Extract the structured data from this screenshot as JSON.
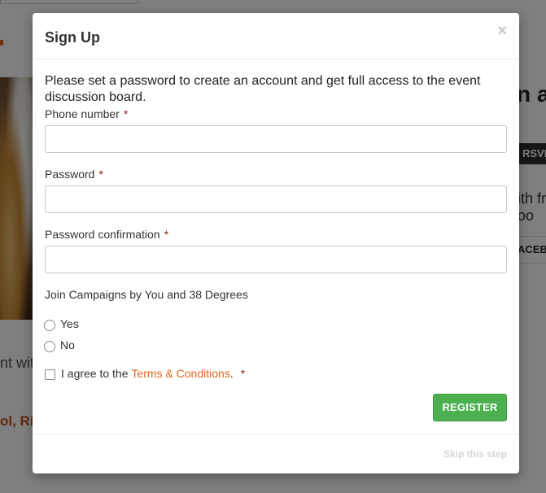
{
  "background": {
    "heading_fragment": "n at",
    "rsvp_label": "RSVP",
    "text_fragment_right": "ith fr\noo",
    "facebook_fragment": "ACEB",
    "text_fragment_left": "nt wit",
    "location_fragment": "ol, Riv"
  },
  "modal": {
    "title": "Sign Up",
    "close_symbol": "×",
    "intro": "Please set a password to create an account and get full access to the event discussion board.",
    "required_marker": "*",
    "fields": {
      "phone": {
        "label": "Phone number",
        "value": ""
      },
      "password": {
        "label": "Password",
        "value": ""
      },
      "password_confirmation": {
        "label": "Password confirmation",
        "value": ""
      }
    },
    "campaigns": {
      "label": "Join Campaigns by You and 38 Degrees",
      "options": [
        "Yes",
        "No"
      ],
      "selected": null
    },
    "terms": {
      "prefix": "I agree to the",
      "link_text": "Terms & Conditions",
      "suffix": ".",
      "checked": false
    },
    "register_label": "REGISTER",
    "skip_label": "Skip this step"
  },
  "colors": {
    "accent": "#e0661b",
    "register_green": "#4caf50",
    "required_red": "#8b1a1a"
  }
}
